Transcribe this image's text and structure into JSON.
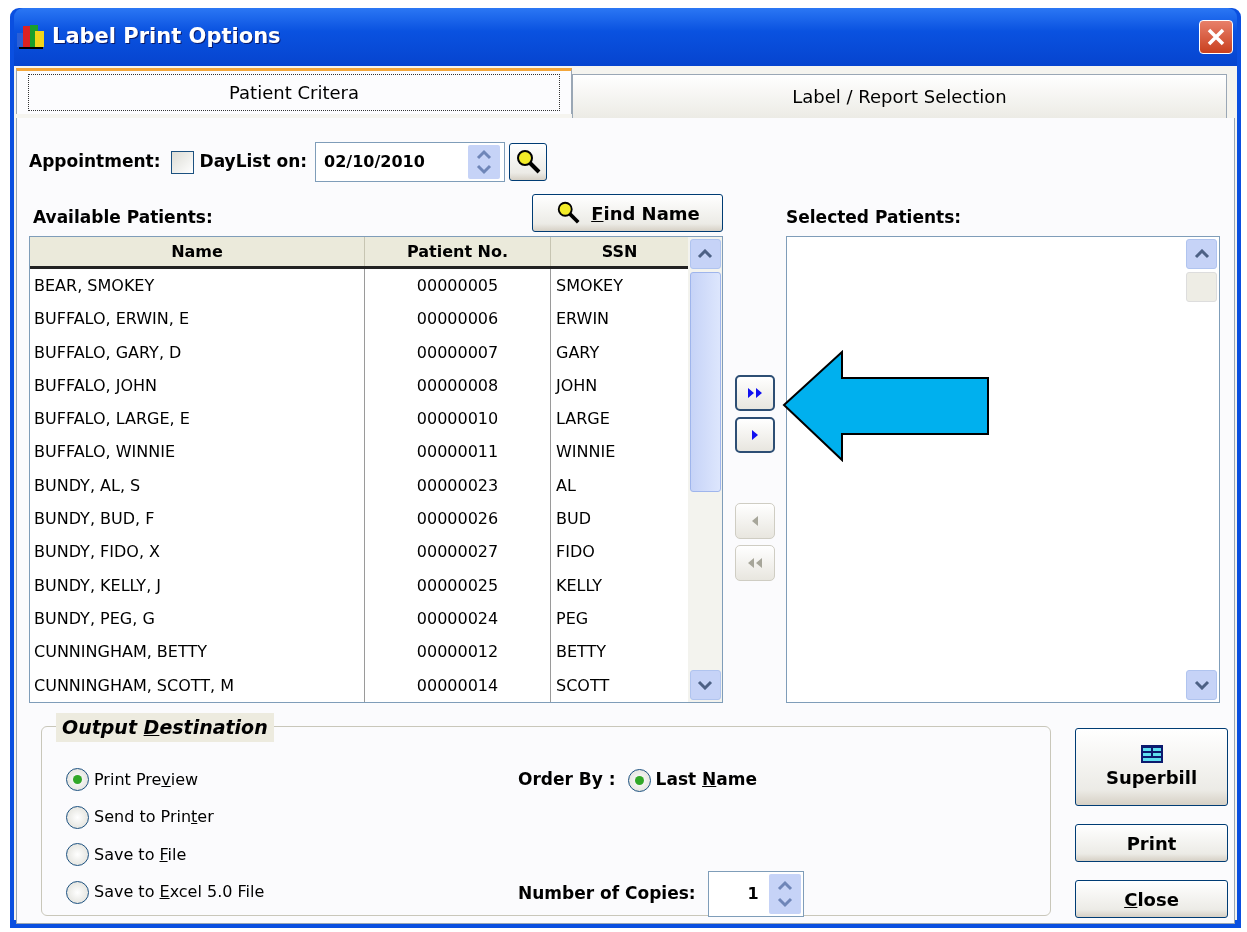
{
  "window": {
    "title": "Label Print Options"
  },
  "tabs": [
    {
      "label": "Patient Critera",
      "selected": true
    },
    {
      "label": "Label / Report Selection",
      "selected": false
    }
  ],
  "appointment": {
    "label": "Appointment:",
    "daylist_label": "DayList on:",
    "daylist_checked": false,
    "date": "02/10/2010"
  },
  "available": {
    "label": "Available Patients:",
    "find_button": {
      "key": "F",
      "after": "ind Name"
    },
    "columns": [
      "Name",
      "Patient No.",
      "SSN"
    ],
    "rows": [
      [
        "BEAR, SMOKEY",
        "00000005",
        "SMOKEY"
      ],
      [
        "BUFFALO, ERWIN, E",
        "00000006",
        "ERWIN"
      ],
      [
        "BUFFALO, GARY, D",
        "00000007",
        "GARY"
      ],
      [
        "BUFFALO, JOHN",
        "00000008",
        "JOHN"
      ],
      [
        "BUFFALO, LARGE, E",
        "00000010",
        "LARGE"
      ],
      [
        "BUFFALO, WINNIE",
        "00000011",
        "WINNIE"
      ],
      [
        "BUNDY, AL, S",
        "00000023",
        "AL"
      ],
      [
        "BUNDY, BUD, F",
        "00000026",
        "BUD"
      ],
      [
        "BUNDY, FIDO, X",
        "00000027",
        "FIDO"
      ],
      [
        "BUNDY, KELLY, J",
        "00000025",
        "KELLY"
      ],
      [
        "BUNDY, PEG, G",
        "00000024",
        "PEG"
      ],
      [
        "CUNNINGHAM, BETTY",
        "00000012",
        "BETTY"
      ],
      [
        "CUNNINGHAM, SCOTT, M",
        "00000014",
        "SCOTT"
      ]
    ]
  },
  "move_buttons": [
    {
      "kind": "add-all",
      "disabled": false
    },
    {
      "kind": "add",
      "disabled": false
    },
    {
      "kind": "remove",
      "disabled": true
    },
    {
      "kind": "remove-all",
      "disabled": true
    }
  ],
  "selected": {
    "label": "Selected Patients:"
  },
  "output": {
    "legend": {
      "before": "Output ",
      "key": "D",
      "after": "estination"
    },
    "options": [
      {
        "before": "Print Pre",
        "key": "v",
        "after": "iew",
        "selected": true
      },
      {
        "before": "Send to Prin",
        "key": "t",
        "after": "er",
        "selected": false
      },
      {
        "before": "Save to ",
        "key": "F",
        "after": "ile",
        "selected": false
      },
      {
        "before": "Save to ",
        "key": "E",
        "after": "xcel 5.0 File",
        "selected": false
      }
    ],
    "order_by": {
      "label": "Order By :",
      "option": {
        "before": "Last ",
        "key": "N",
        "after": "ame",
        "selected": true
      }
    },
    "copies": {
      "label": "Number of Copies:",
      "value": "1"
    }
  },
  "buttons": [
    {
      "kind": "superbill",
      "before": "Superbill"
    },
    {
      "kind": "print",
      "before": "Print"
    },
    {
      "kind": "close",
      "key": "C",
      "after": "lose"
    }
  ]
}
